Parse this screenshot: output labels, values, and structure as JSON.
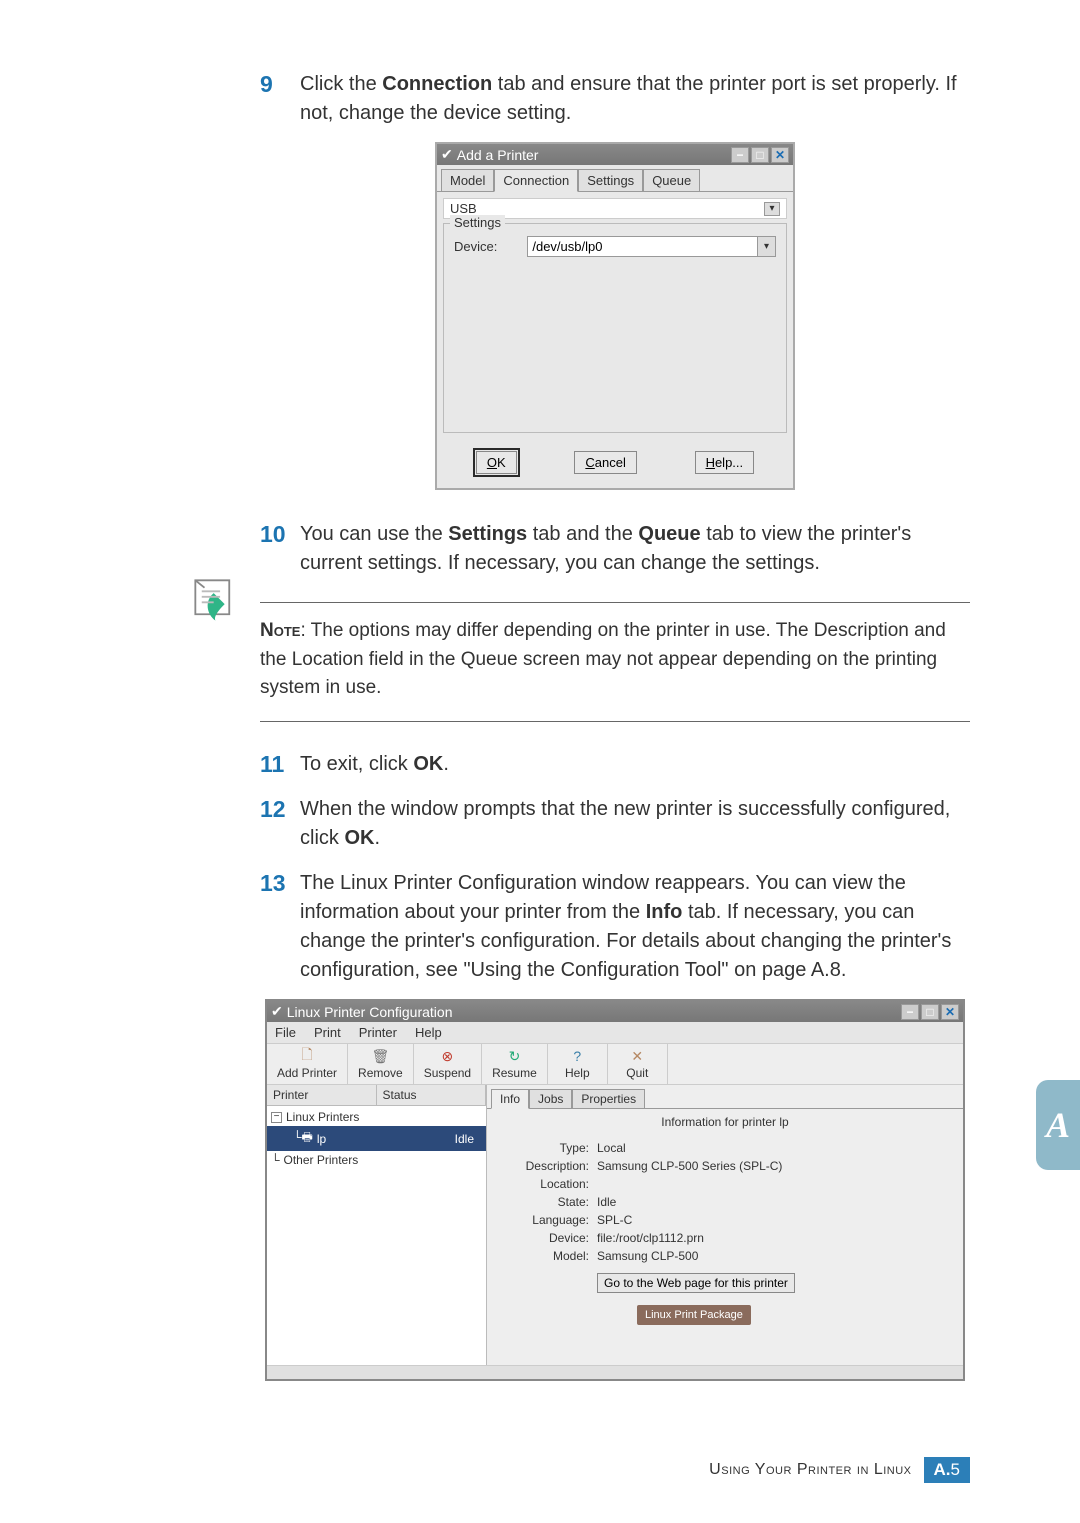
{
  "step9": {
    "num": "9",
    "pre": "Click the ",
    "bold": "Connection",
    "post": " tab and ensure that the printer port is set properly. If not, change the device setting."
  },
  "dialog1": {
    "title": "Add a Printer",
    "tabs": [
      "Model",
      "Connection",
      "Settings",
      "Queue"
    ],
    "active_tab_index": 1,
    "type_value": "USB",
    "settings_label": "Settings",
    "device_label": "Device:",
    "device_value": "/dev/usb/lp0",
    "buttons": {
      "ok": "OK",
      "cancel": "Cancel",
      "help": "Help..."
    }
  },
  "step10": {
    "num": "10",
    "p1": "You can use the ",
    "b1": "Settings",
    "p2": " tab and the ",
    "b2": "Queue",
    "p3": " tab to view the printer's current settings. If necessary, you can change the settings."
  },
  "note": {
    "label": "Note",
    "text": ": The options may differ depending on the printer in use. The Description and the Location field in the Queue screen may not appear depending on the printing system in use."
  },
  "step11": {
    "num": "11",
    "pre": "To exit, click ",
    "b": "OK",
    "post": "."
  },
  "step12": {
    "num": "12",
    "pre": "When the window prompts that the new printer is successfully configured, click ",
    "b": "OK",
    "post": "."
  },
  "step13": {
    "num": "13",
    "p1": "The Linux Printer Configuration window reappears. You can view the information about your printer from the ",
    "b": "Info",
    "p2": " tab. If necessary, you can change the printer's configuration. For details about changing the printer's configuration, see \"Using the Configuration Tool\" on page A.8."
  },
  "dialog2": {
    "title": "Linux Printer Configuration",
    "menubar": [
      "File",
      "Print",
      "Printer",
      "Help"
    ],
    "toolbar": [
      {
        "icon": "🗋",
        "label": "Add Printer"
      },
      {
        "icon": "🗑",
        "label": "Remove"
      },
      {
        "icon": "⊗",
        "label": "Suspend"
      },
      {
        "icon": "↻",
        "label": "Resume"
      },
      {
        "icon": "?",
        "label": "Help"
      },
      {
        "icon": "✕",
        "label": "Quit"
      }
    ],
    "tree_headers": [
      "Printer",
      "Status"
    ],
    "tree": [
      {
        "expand": "−",
        "name": "Linux Printers",
        "status": "",
        "selected": false,
        "indent": 0
      },
      {
        "expand": "",
        "name": "lp",
        "status": "Idle",
        "selected": true,
        "indent": 1
      },
      {
        "expand": "",
        "name": "Other Printers",
        "status": "",
        "selected": false,
        "indent": 0
      }
    ],
    "tabs": [
      "Info",
      "Jobs",
      "Properties"
    ],
    "active_tab_index": 0,
    "info_title": "Information for printer lp",
    "info": [
      {
        "label": "Type:",
        "value": "Local"
      },
      {
        "label": "Description:",
        "value": "Samsung CLP-500 Series (SPL-C)"
      },
      {
        "label": "Location:",
        "value": ""
      },
      {
        "label": "State:",
        "value": "Idle"
      },
      {
        "label": "Language:",
        "value": "SPL-C"
      },
      {
        "label": "Device:",
        "value": "file:/root/clp1112.prn"
      },
      {
        "label": "Model:",
        "value": "Samsung CLP-500"
      }
    ],
    "web_btn": "Go to the Web page for this printer",
    "logo": "Linux Print Package"
  },
  "side_letter": "A",
  "footer": {
    "text": "Using Your Printer in Linux",
    "page_prefix": "A.",
    "page_num": "5"
  }
}
